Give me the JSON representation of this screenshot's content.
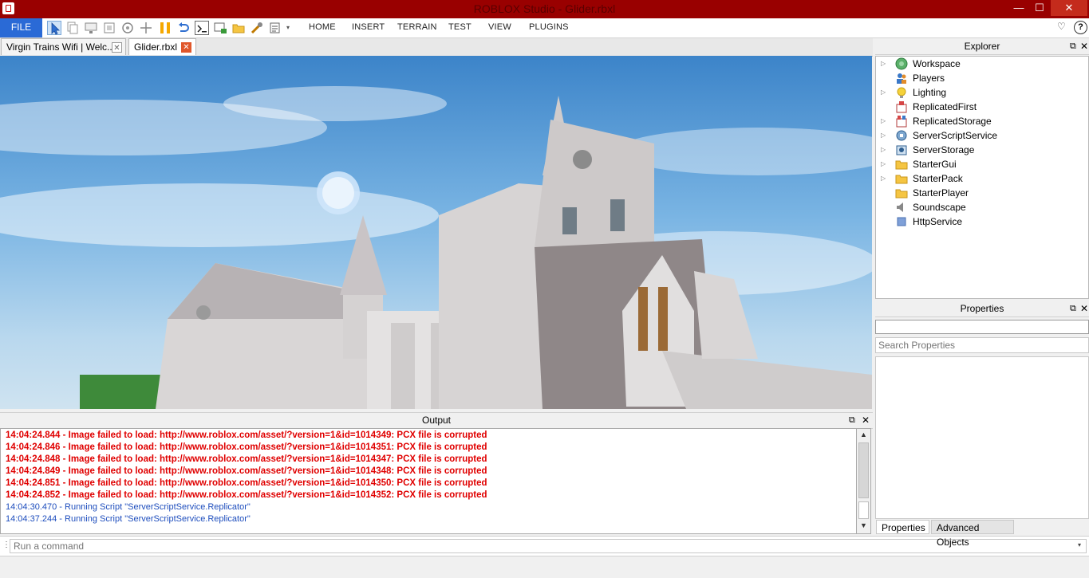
{
  "window": {
    "title": "ROBLOX Studio - Glider.rbxl",
    "minimize": "—",
    "maximize": "☐",
    "close": "✕"
  },
  "menubar": {
    "file_label": "FILE",
    "tabs": [
      "HOME",
      "INSERT",
      "TERRAIN",
      "TEST",
      "VIEW",
      "PLUGINS"
    ]
  },
  "doc_tabs": [
    {
      "label": "Virgin Trains Wifi | Welc...",
      "close": "✕"
    },
    {
      "label": "Glider.rbxl",
      "close": "✕"
    }
  ],
  "output": {
    "title": "Output",
    "lines": [
      {
        "text": "14:04:24.844 - Image failed to load: http://www.roblox.com/asset/?version=1&id=1014349: PCX file is corrupted",
        "kind": "error"
      },
      {
        "text": "14:04:24.846 - Image failed to load: http://www.roblox.com/asset/?version=1&id=1014351: PCX file is corrupted",
        "kind": "error"
      },
      {
        "text": "14:04:24.848 - Image failed to load: http://www.roblox.com/asset/?version=1&id=1014347: PCX file is corrupted",
        "kind": "error"
      },
      {
        "text": "14:04:24.849 - Image failed to load: http://www.roblox.com/asset/?version=1&id=1014348: PCX file is corrupted",
        "kind": "error"
      },
      {
        "text": "14:04:24.851 - Image failed to load: http://www.roblox.com/asset/?version=1&id=1014350: PCX file is corrupted",
        "kind": "error"
      },
      {
        "text": "14:04:24.852 - Image failed to load: http://www.roblox.com/asset/?version=1&id=1014352: PCX file is corrupted",
        "kind": "error"
      },
      {
        "text": "14:04:30.470 - Running Script \"ServerScriptService.Replicator\"",
        "kind": "info"
      },
      {
        "text": "14:04:37.244 - Running Script \"ServerScriptService.Replicator\"",
        "kind": "info"
      }
    ]
  },
  "command_bar": {
    "placeholder": "Run a command"
  },
  "explorer": {
    "title": "Explorer",
    "items": [
      {
        "label": "Workspace",
        "icon": "workspace-icon"
      },
      {
        "label": "Players",
        "icon": "players-icon"
      },
      {
        "label": "Lighting",
        "icon": "lighting-icon"
      },
      {
        "label": "ReplicatedFirst",
        "icon": "replicated-first-icon"
      },
      {
        "label": "ReplicatedStorage",
        "icon": "replicated-storage-icon"
      },
      {
        "label": "ServerScriptService",
        "icon": "server-script-service-icon"
      },
      {
        "label": "ServerStorage",
        "icon": "server-storage-icon"
      },
      {
        "label": "StarterGui",
        "icon": "starter-gui-icon"
      },
      {
        "label": "StarterPack",
        "icon": "starter-pack-icon"
      },
      {
        "label": "StarterPlayer",
        "icon": "starter-player-icon"
      },
      {
        "label": "Soundscape",
        "icon": "soundscape-icon"
      },
      {
        "label": "HttpService",
        "icon": "http-service-icon"
      }
    ]
  },
  "properties": {
    "title": "Properties",
    "search_placeholder": "Search Properties",
    "tabs": [
      "Properties",
      "Advanced Objects"
    ]
  },
  "colors": {
    "titlebar": "#990000",
    "accent": "#2a6ad6",
    "error_text": "#e00000",
    "info_text": "#1d4dbd"
  }
}
